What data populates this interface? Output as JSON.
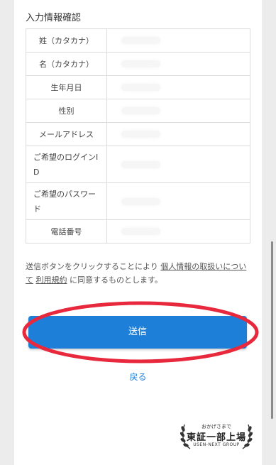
{
  "section_title": "入力情報確認",
  "rows": [
    {
      "label": "姓（カタカナ）"
    },
    {
      "label": "名（カタカナ）"
    },
    {
      "label": "生年月日"
    },
    {
      "label": "性別"
    },
    {
      "label": "メールアドレス"
    },
    {
      "label": "ご希望のログインI\nD"
    },
    {
      "label": "ご希望のパスワー\nド"
    },
    {
      "label": "電話番号"
    }
  ],
  "consent": {
    "prefix": "送信ボタンをクリックすることにより",
    "link_privacy": "個人情報の取扱いについて",
    "link_terms": "利用規約",
    "suffix": "に同意するものとします。"
  },
  "submit_label": "送信",
  "back_label": "戻る",
  "badge": {
    "small": "おかげさまで",
    "main": "東証一部上場",
    "sub": "USEN-NEXT GROUP"
  },
  "colors": {
    "primary": "#1e7fd9",
    "annotation": "#e8283c"
  }
}
